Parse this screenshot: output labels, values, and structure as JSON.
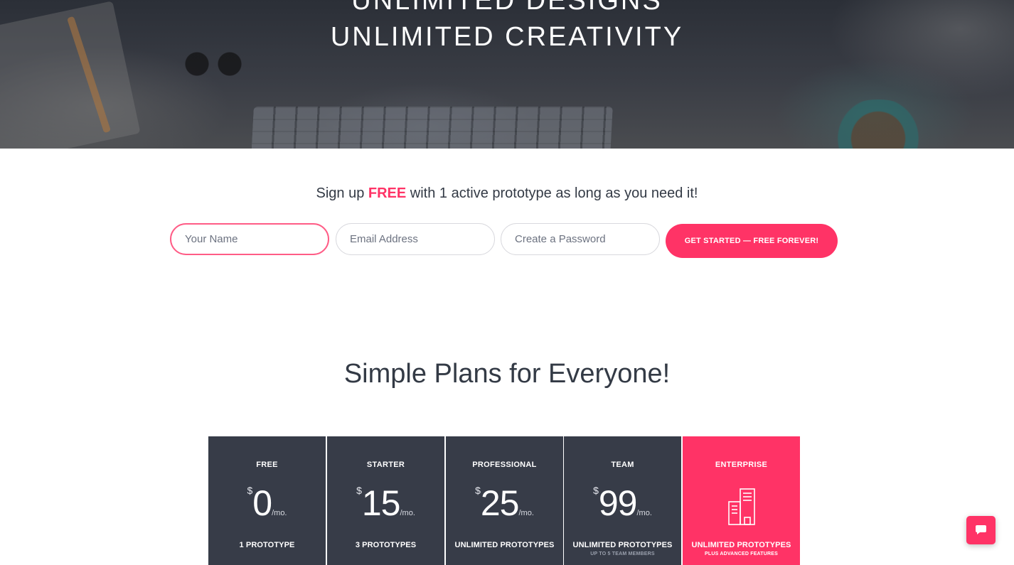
{
  "hero": {
    "title_line1": "UNLIMITED DESIGNS",
    "title_line2": "UNLIMITED CREATIVITY"
  },
  "signup": {
    "text_before": "Sign up ",
    "text_highlight": "FREE",
    "text_after": " with 1 active prototype as long as you need it!",
    "name_placeholder": "Your Name",
    "email_placeholder": "Email Address",
    "password_placeholder": "Create a Password",
    "cta_label": "GET STARTED — FREE FOREVER!"
  },
  "plans_section": {
    "title": "Simple Plans for Everyone!",
    "plans": [
      {
        "name": "FREE",
        "currency": "$",
        "amount": "0",
        "period": "/mo.",
        "feature": "1 PROTOTYPE",
        "sub": ""
      },
      {
        "name": "STARTER",
        "currency": "$",
        "amount": "15",
        "period": "/mo.",
        "feature": "3 PROTOTYPES",
        "sub": ""
      },
      {
        "name": "PROFESSIONAL",
        "currency": "$",
        "amount": "25",
        "period": "/mo.",
        "feature": "UNLIMITED PROTOTYPES",
        "sub": ""
      },
      {
        "name": "TEAM",
        "currency": "$",
        "amount": "99",
        "period": "/mo.",
        "feature": "UNLIMITED PROTOTYPES",
        "sub": "UP TO 5 TEAM MEMBERS"
      },
      {
        "name": "ENTERPRISE",
        "icon": "building-icon",
        "feature": "UNLIMITED PROTOTYPES",
        "sub": "PLUS ADVANCED FEATURES"
      }
    ]
  },
  "chat": {
    "icon": "chat-bubble-icon"
  },
  "colors": {
    "accent": "#ff3366",
    "plan_card": "#373c48",
    "text_dark": "#333a45"
  }
}
